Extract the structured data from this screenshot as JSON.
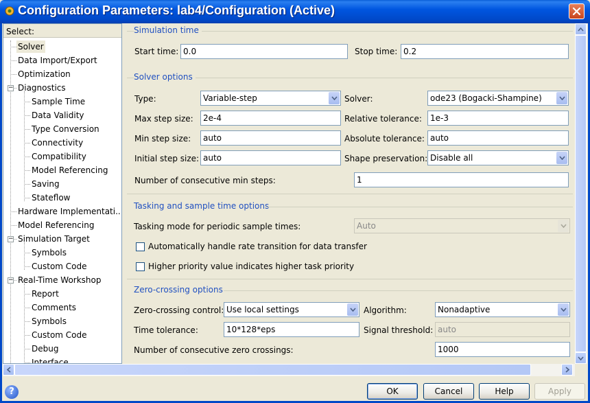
{
  "window": {
    "title": "Configuration Parameters: lab4/Configuration (Active)"
  },
  "tree": {
    "header": "Select:",
    "items": [
      {
        "label": "Solver",
        "level": 0,
        "selected": true
      },
      {
        "label": "Data Import/Export",
        "level": 0
      },
      {
        "label": "Optimization",
        "level": 0
      },
      {
        "label": "Diagnostics",
        "level": 0,
        "expanded": true
      },
      {
        "label": "Sample Time",
        "level": 1
      },
      {
        "label": "Data Validity",
        "level": 1
      },
      {
        "label": "Type Conversion",
        "level": 1
      },
      {
        "label": "Connectivity",
        "level": 1
      },
      {
        "label": "Compatibility",
        "level": 1
      },
      {
        "label": "Model Referencing",
        "level": 1
      },
      {
        "label": "Saving",
        "level": 1
      },
      {
        "label": "Stateflow",
        "level": 1
      },
      {
        "label": "Hardware Implementati...",
        "level": 0
      },
      {
        "label": "Model Referencing",
        "level": 0
      },
      {
        "label": "Simulation Target",
        "level": 0,
        "expanded": true
      },
      {
        "label": "Symbols",
        "level": 1
      },
      {
        "label": "Custom Code",
        "level": 1
      },
      {
        "label": "Real-Time Workshop",
        "level": 0,
        "expanded": true
      },
      {
        "label": "Report",
        "level": 1
      },
      {
        "label": "Comments",
        "level": 1
      },
      {
        "label": "Symbols",
        "level": 1
      },
      {
        "label": "Custom Code",
        "level": 1
      },
      {
        "label": "Debug",
        "level": 1
      },
      {
        "label": "Interface",
        "level": 1
      }
    ]
  },
  "simulation_time": {
    "title": "Simulation time",
    "start_label": "Start time:",
    "start_value": "0.0",
    "stop_label": "Stop time:",
    "stop_value": "0.2"
  },
  "solver_options": {
    "title": "Solver options",
    "type_label": "Type:",
    "type_value": "Variable-step",
    "solver_label": "Solver:",
    "solver_value": "ode23 (Bogacki-Shampine)",
    "max_step_label": "Max step size:",
    "max_step_value": "2e-4",
    "rel_tol_label": "Relative tolerance:",
    "rel_tol_value": "1e-3",
    "min_step_label": "Min step size:",
    "min_step_value": "auto",
    "abs_tol_label": "Absolute tolerance:",
    "abs_tol_value": "auto",
    "init_step_label": "Initial step size:",
    "init_step_value": "auto",
    "shape_label": "Shape preservation:",
    "shape_value": "Disable all",
    "consec_label": "Number of consecutive min steps:",
    "consec_value": "1"
  },
  "tasking": {
    "title": "Tasking and sample time options",
    "mode_label": "Tasking mode for periodic sample times:",
    "mode_value": "Auto",
    "rate_transition_label": "Automatically handle rate transition for data transfer",
    "priority_label": "Higher priority value indicates higher task priority"
  },
  "zero_crossing": {
    "title": "Zero-crossing options",
    "control_label": "Zero-crossing control:",
    "control_value": "Use local settings",
    "algorithm_label": "Algorithm:",
    "algorithm_value": "Nonadaptive",
    "time_tol_label": "Time tolerance:",
    "time_tol_value": "10*128*eps",
    "signal_label": "Signal threshold:",
    "signal_value": "auto",
    "consec_label": "Number of consecutive zero crossings:",
    "consec_value": "1000"
  },
  "buttons": {
    "ok": "OK",
    "cancel": "Cancel",
    "help": "Help",
    "apply": "Apply"
  },
  "help_icon": "?",
  "icons": {
    "close": "close-icon",
    "dropdown": "chevron-down-icon",
    "app": "simulink-icon"
  },
  "colors": {
    "titlebar": "#0054e3",
    "group_title": "#2050c0",
    "window_bg": "#ece9d8"
  }
}
